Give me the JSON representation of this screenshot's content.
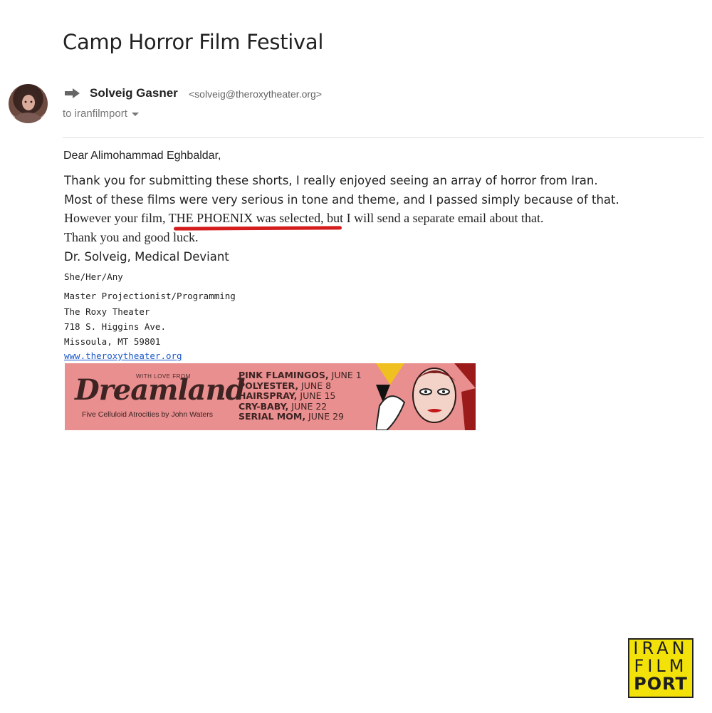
{
  "email": {
    "subject": "Camp Horror Film Festival",
    "sender_name": "Solveig Gasner",
    "sender_email": "<solveig@theroxytheater.org>",
    "to_label": "to iranfilmport",
    "greeting": "Dear Alimohammad Eghbaldar,",
    "body_line1": "Thank you for submitting these shorts, I really enjoyed seeing an array of horror from Iran.",
    "body_line2": "Most of these films were very serious in tone and theme, and I passed simply because of that.",
    "body_line3_pre": "However your film, ",
    "body_line3_highlight": "THE PHOENIX was selected,",
    "body_line3_post": " but I will send a separate email about that.",
    "body_line4": "Thank you and good luck.",
    "signoff": "Dr. Solveig, Medical Deviant",
    "pronouns": "She/Her/Any",
    "role": "Master Projectionist/Programming",
    "venue": "The Roxy Theater",
    "address1": "718 S. Higgins Ave.",
    "address2": "Missoula, MT  59801",
    "website": "www.theroxytheater.org"
  },
  "banner": {
    "with_love": "WITH LOVE FROM",
    "title": "Dreamland",
    "subtitle": "Five Celluloid Atrocities by John Waters",
    "films": [
      {
        "name": "PINK FLAMINGOS,",
        "date": " JUNE 1"
      },
      {
        "name": "POLYESTER,",
        "date": " JUNE 8"
      },
      {
        "name": "HAIRSPRAY,",
        "date": " JUNE 15"
      },
      {
        "name": "CRY-BABY,",
        "date": " JUNE 22"
      },
      {
        "name": "SERIAL MOM,",
        "date": " JUNE 29"
      }
    ]
  },
  "logo": {
    "line1": "IRAN",
    "line2": "FILM",
    "line3": "PORT"
  },
  "colors": {
    "highlight_underline": "#d41c1c",
    "link": "#1a57c9",
    "banner_bg": "#e98f8f",
    "logo_bg": "#f2e20a"
  },
  "icons": [
    "forward-icon",
    "dropdown-caret-icon"
  ]
}
